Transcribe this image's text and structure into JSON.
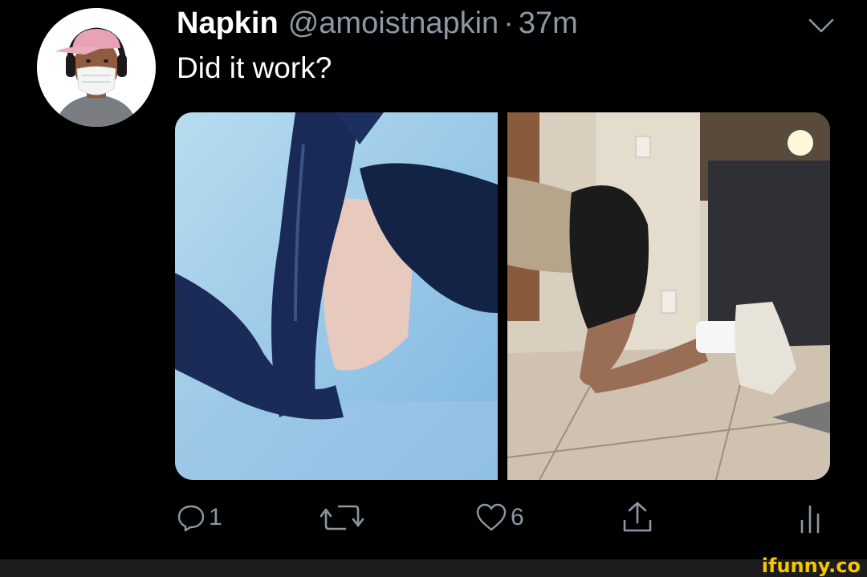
{
  "tweet": {
    "display_name": "Napkin",
    "handle": "@amoistnapkin",
    "separator": "·",
    "time": "37m",
    "text": "Did it work?",
    "media_count": 2
  },
  "actions": {
    "reply_count": "1",
    "retweet_count": "",
    "like_count": "6"
  },
  "icons": {
    "reply": "speech-bubble-icon",
    "retweet": "retweet-arrows-icon",
    "like": "heart-icon",
    "share": "share-upload-icon",
    "analytics": "bar-chart-icon",
    "more": "chevron-down-icon"
  },
  "watermark": "ifunny.co",
  "colors": {
    "background": "#000000",
    "text_primary": "#ffffff",
    "text_secondary": "#8b98a5",
    "watermark": "#f6c600"
  }
}
